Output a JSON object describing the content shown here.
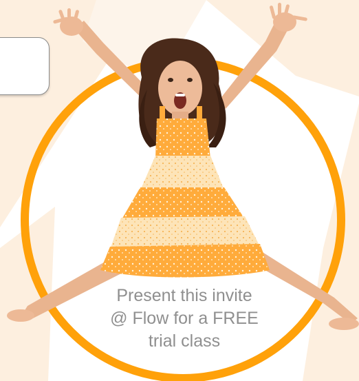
{
  "invite": {
    "line1": "Present this invite",
    "line2": "@ Flow for a FREE",
    "line3": "trial class"
  },
  "colors": {
    "ring": "#ffa10a",
    "dress": "#ffab3b",
    "dress_light": "#fde4b8",
    "background_wedge": "#fdeedd",
    "text": "#8f8f8f"
  }
}
